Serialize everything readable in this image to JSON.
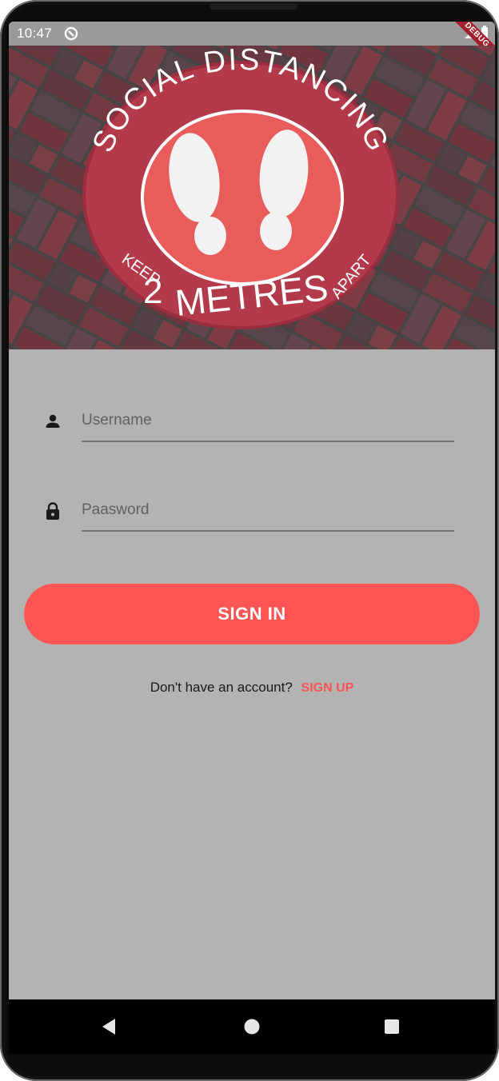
{
  "status_bar": {
    "time": "10:47",
    "debug_banner": "DEBUG"
  },
  "hero": {
    "sign_top_text": "SOCIAL DISTANCING",
    "sign_left_text": "KEEP",
    "sign_number": "2",
    "sign_unit": "METRES",
    "sign_right_text": "APART"
  },
  "login": {
    "username_placeholder": "Username",
    "password_placeholder": "Paasword",
    "signin_label": "SIGN IN",
    "no_account_text": "Don't have an account?",
    "signup_label": "SIGN UP"
  },
  "colors": {
    "accent": "#fd5553",
    "background": "#b3b3b3",
    "status_bar": "#9a9a9a"
  },
  "icons": {
    "username": "person-icon",
    "password": "lock-icon",
    "nav_back": "back-triangle-icon",
    "nav_home": "home-circle-icon",
    "nav_recents": "recents-square-icon"
  }
}
